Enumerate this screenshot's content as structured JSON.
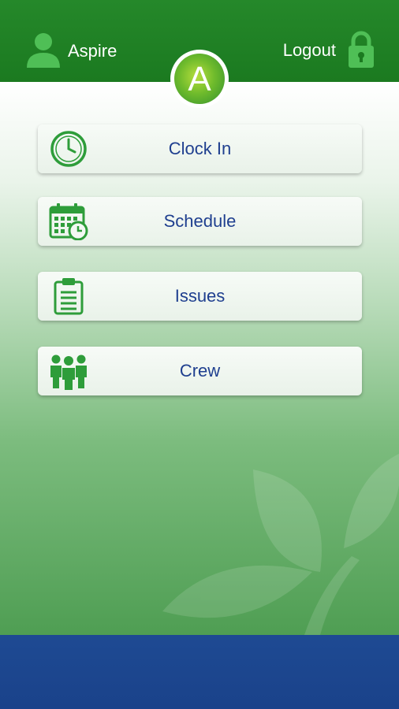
{
  "header": {
    "user_name": "Aspire",
    "logout_label": "Logout",
    "logo_letter": "A",
    "background_color": "#1b7a20"
  },
  "menu": [
    {
      "label": "Clock In",
      "icon": "clock-icon"
    },
    {
      "label": "Schedule",
      "icon": "calendar-clock-icon"
    },
    {
      "label": "Issues",
      "icon": "clipboard-icon"
    },
    {
      "label": "Crew",
      "icon": "crew-icon"
    }
  ],
  "colors": {
    "accent_green": "#2e9d3a",
    "label_blue": "#1f3f8f",
    "footer_blue": "#1a428a"
  }
}
